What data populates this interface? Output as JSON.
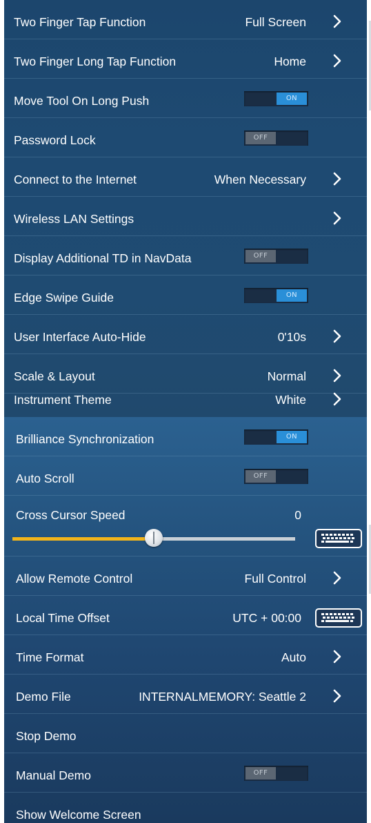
{
  "settings": {
    "rows": [
      {
        "label": "Two Finger Tap Function",
        "value": "Full Screen"
      },
      {
        "label": "Two Finger Long Tap Function",
        "value": "Home"
      },
      {
        "label": "Move Tool On Long Push",
        "toggle": "ON"
      },
      {
        "label": "Password Lock",
        "toggle": "OFF"
      },
      {
        "label": "Connect to the Internet",
        "value": "When Necessary"
      },
      {
        "label": "Wireless LAN Settings"
      },
      {
        "label": "Display Additional TD in NavData",
        "toggle": "OFF"
      },
      {
        "label": "Edge Swipe Guide",
        "toggle": "ON"
      },
      {
        "label": "User Interface Auto-Hide",
        "value": "0'10s"
      },
      {
        "label": "Scale & Layout",
        "value": "Normal"
      },
      {
        "label": "Instrument Theme",
        "value": "White"
      },
      {
        "label": "Brilliance Synchronization",
        "toggle": "ON"
      },
      {
        "label": "Auto Scroll",
        "toggle": "OFF"
      },
      {
        "label": "Cross Cursor Speed",
        "value": "0",
        "slider_level": 0.5
      },
      {
        "label": "Allow Remote Control",
        "value": "Full Control"
      },
      {
        "label": "Local Time Offset",
        "value": "UTC + 00:00"
      },
      {
        "label": "Time Format",
        "value": "Auto"
      },
      {
        "label": "Demo File",
        "value": "INTERNALMEMORY: Seattle 2"
      },
      {
        "label": "Stop Demo"
      },
      {
        "label": "Manual Demo",
        "toggle": "OFF"
      },
      {
        "label": "Show Welcome Screen"
      }
    ]
  },
  "icons": {
    "chevron": "chevron-right-icon",
    "keyboard": "keyboard-icon"
  },
  "colors": {
    "panel_top": "#1e4a72",
    "panel_bottom_section": "#2b6190",
    "toggle_on": "#2a8fd8",
    "toggle_off": "#5b6673",
    "slider_fill": "#f1b41a",
    "text": "#ffffff"
  }
}
